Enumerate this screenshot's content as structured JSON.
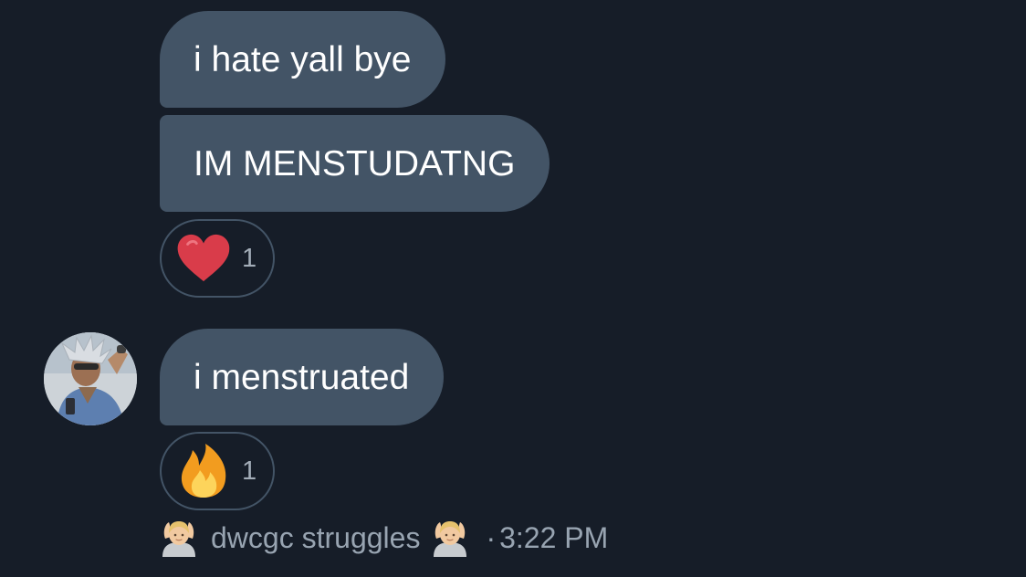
{
  "messages": [
    {
      "text": "i hate yall bye"
    },
    {
      "text": "IM MENSTUDATNG"
    },
    {
      "text": "i menstruated"
    }
  ],
  "reactions": [
    {
      "emoji": "red-heart-icon",
      "count": "1"
    },
    {
      "emoji": "fire-icon",
      "count": "1"
    }
  ],
  "meta": {
    "sender": "dwcgc struggles",
    "separator": "·",
    "time": "3:22 PM",
    "emoji": "person-gesturing-ok-icon"
  },
  "colors": {
    "background": "#161d28",
    "bubble": "#435466",
    "text": "#ffffff",
    "muted": "#98a4b1",
    "heart": "#d93c4a",
    "fire": "#f29c1f"
  }
}
